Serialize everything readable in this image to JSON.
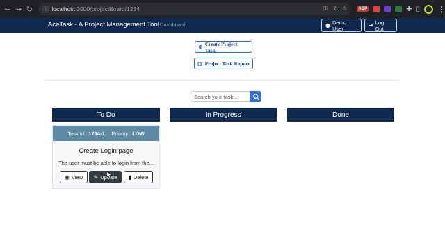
{
  "browser": {
    "url_host": "localhost",
    "url_path": ":3000/projectBoard/1234",
    "ext_abp_label": "ABP"
  },
  "navbar": {
    "brand": "AceTask - A Project Management Tool",
    "dashboard_link": "Dashboard",
    "user_button": "Demo User",
    "logout_button": "Log Out"
  },
  "actions": {
    "create_task": "Create Project Task",
    "task_report": "Project Task Report"
  },
  "search": {
    "placeholder": "Search your task...."
  },
  "columns": {
    "todo": "To Do",
    "in_progress": "In Progress",
    "done": "Done"
  },
  "task_card": {
    "task_id_label": "Task Id :",
    "task_id": "1234-1",
    "priority_label": "Priority :",
    "priority": "LOW",
    "title": "Create Login page",
    "description": "The user must be able to login from the...",
    "view_button": "View",
    "update_button": "Update",
    "delete_button": "Delete"
  },
  "colors": {
    "navbar_bg": "#0f2a4e",
    "card_header_bg": "#5f8aa3",
    "accent_blue": "#2f6fd6"
  }
}
